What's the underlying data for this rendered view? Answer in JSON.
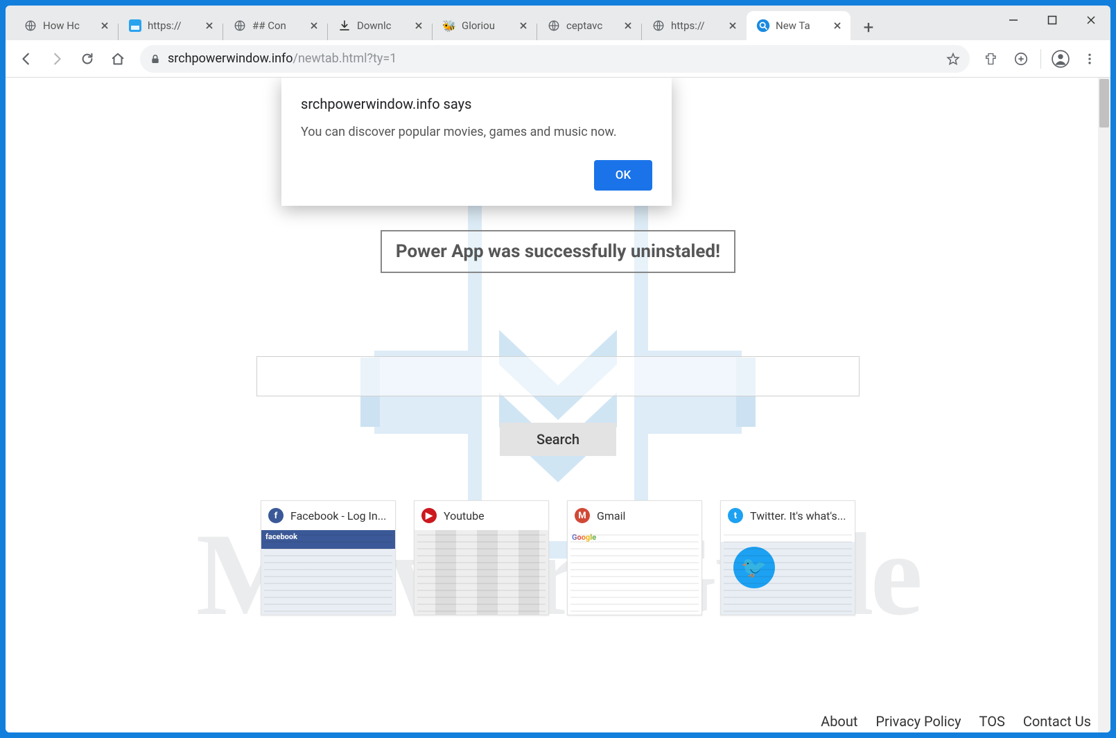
{
  "window_controls": {
    "minimize": "minimize",
    "maximize": "maximize",
    "close": "close"
  },
  "tabs": [
    {
      "title": "How Hc",
      "favicon": "globe"
    },
    {
      "title": "https://",
      "favicon": "blue-square"
    },
    {
      "title": "## Con",
      "favicon": "globe"
    },
    {
      "title": "Downlc",
      "favicon": "download"
    },
    {
      "title": "Gloriou",
      "favicon": "bee"
    },
    {
      "title": "ceptavc",
      "favicon": "globe"
    },
    {
      "title": "https://",
      "favicon": "globe"
    },
    {
      "title": "New Ta",
      "favicon": "search-blue",
      "active": true
    }
  ],
  "omnibox": {
    "host": "srchpowerwindow.info",
    "path": "/newtab.html?ty=1"
  },
  "dialog": {
    "origin": "srchpowerwindow.info says",
    "message": "You can discover popular movies, games and music now.",
    "ok_label": "OK"
  },
  "page": {
    "status_banner": "Power App was successfully uninstaled!",
    "search_button": "Search",
    "search_value": ""
  },
  "tiles": [
    {
      "title": "Facebook - Log In...",
      "icon_bg": "#3b5998",
      "icon_letter": "f",
      "thumb": "fb"
    },
    {
      "title": "Youtube",
      "icon_bg": "#cc181e",
      "icon_letter": "▶",
      "thumb": "yt"
    },
    {
      "title": "Gmail",
      "icon_bg": "#d14836",
      "icon_letter": "M",
      "thumb": "gm"
    },
    {
      "title": "Twitter. It's what's...",
      "icon_bg": "#1da1f2",
      "icon_letter": "t",
      "thumb": "tw"
    }
  ],
  "footer": [
    {
      "label": "About"
    },
    {
      "label": "Privacy Policy"
    },
    {
      "label": "TOS"
    },
    {
      "label": "Contact Us"
    }
  ],
  "watermark_text": "MalwareGuide"
}
